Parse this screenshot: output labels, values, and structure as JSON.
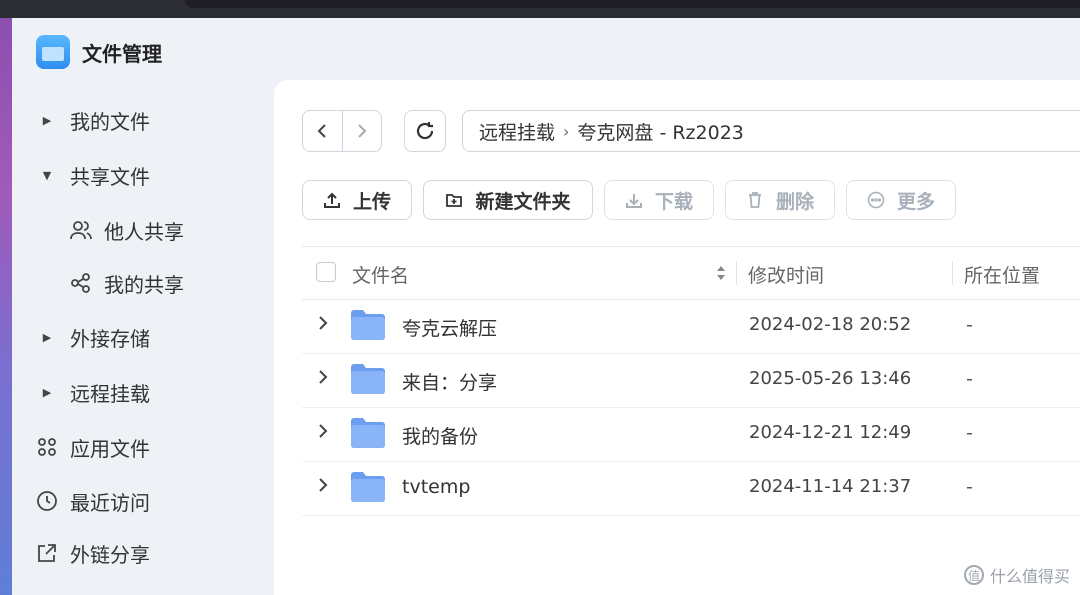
{
  "app": {
    "title": "文件管理"
  },
  "sidebar": {
    "items": [
      {
        "label": "我的文件",
        "kind": "caret",
        "caret": "▶"
      },
      {
        "label": "共享文件",
        "kind": "caret",
        "caret": "▼"
      },
      {
        "label": "他人共享",
        "kind": "sub",
        "icon": "users-icon"
      },
      {
        "label": "我的共享",
        "kind": "sub",
        "icon": "share-icon"
      },
      {
        "label": "外接存储",
        "kind": "caret",
        "caret": "▶"
      },
      {
        "label": "远程挂载",
        "kind": "caret",
        "caret": "▶"
      },
      {
        "label": "应用文件",
        "kind": "icon",
        "icon": "apps-grid-icon"
      },
      {
        "label": "最近访问",
        "kind": "icon",
        "icon": "clock-icon"
      },
      {
        "label": "外链分享",
        "kind": "icon",
        "icon": "external-share-icon"
      }
    ]
  },
  "path": {
    "crumb1": "远程挂载",
    "separator": "›",
    "crumb2": "夸克网盘 - Rz2023"
  },
  "toolbar": {
    "upload": "上传",
    "new_folder": "新建文件夹",
    "download": "下载",
    "delete": "删除",
    "more": "更多"
  },
  "table": {
    "headers": {
      "name": "文件名",
      "modified": "修改时间",
      "location": "所在位置"
    },
    "rows": [
      {
        "name": "夸克云解压",
        "modified": "2024-02-18 20:52",
        "location": "-"
      },
      {
        "name": "来自：分享",
        "modified": "2025-05-26 13:46",
        "location": "-"
      },
      {
        "name": "我的备份",
        "modified": "2024-12-21 12:49",
        "location": "-"
      },
      {
        "name": "tvtemp",
        "modified": "2024-11-14 21:37",
        "location": "-"
      }
    ]
  },
  "watermark": {
    "text": "什么值得买",
    "badge": "值"
  },
  "colors": {
    "folder": "#8ab4f8",
    "folder_dark": "#6c9ef0",
    "app_bg": "#eef2f7",
    "accent": "#2f8df0"
  }
}
